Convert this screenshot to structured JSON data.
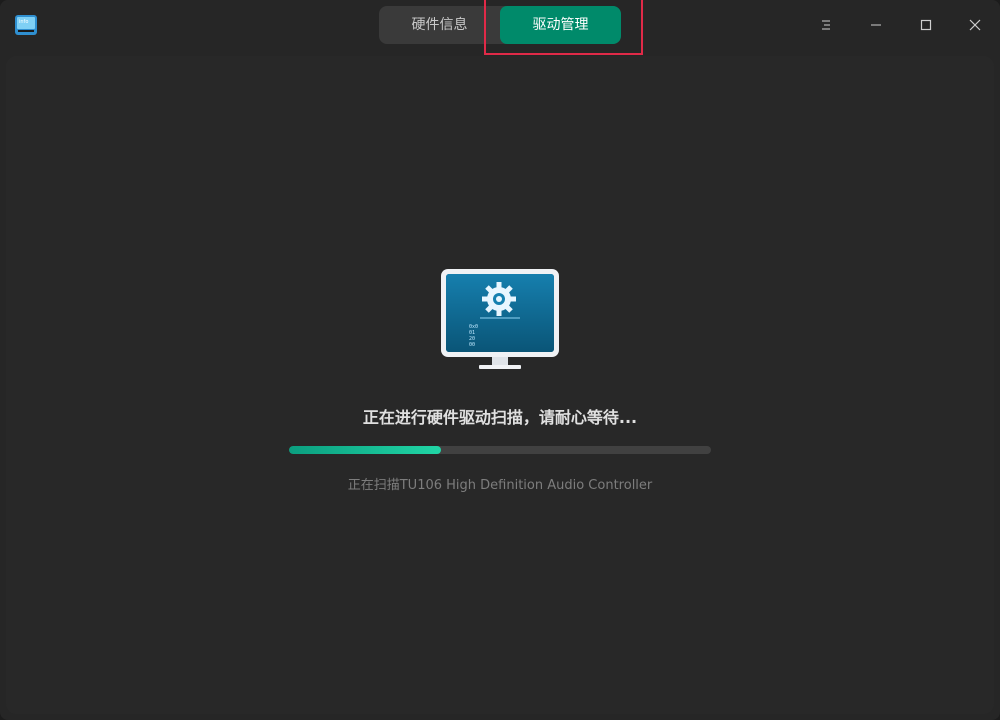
{
  "app": {
    "icon_name": "device-manager-icon"
  },
  "tabs": [
    {
      "label": "硬件信息",
      "active": false
    },
    {
      "label": "驱动管理",
      "active": true
    }
  ],
  "window_controls": {
    "menu_icon": "menu-icon",
    "minimize_icon": "minimize-icon",
    "maximize_icon": "maximize-icon",
    "close_icon": "close-icon"
  },
  "scan": {
    "title": "正在进行硬件驱动扫描，请耐心等待...",
    "progress": 0.36,
    "detail": "正在扫描TU106 High Definition Audio Controller"
  },
  "illustration": {
    "icon_name": "monitor-gear-icon",
    "code_lines": [
      "0x0",
      "01",
      "20",
      "00"
    ]
  },
  "colors": {
    "accent": "#008a6a",
    "progress_start": "#0b9f80",
    "progress_end": "#21d6a6",
    "highlight": "#e02a48"
  }
}
